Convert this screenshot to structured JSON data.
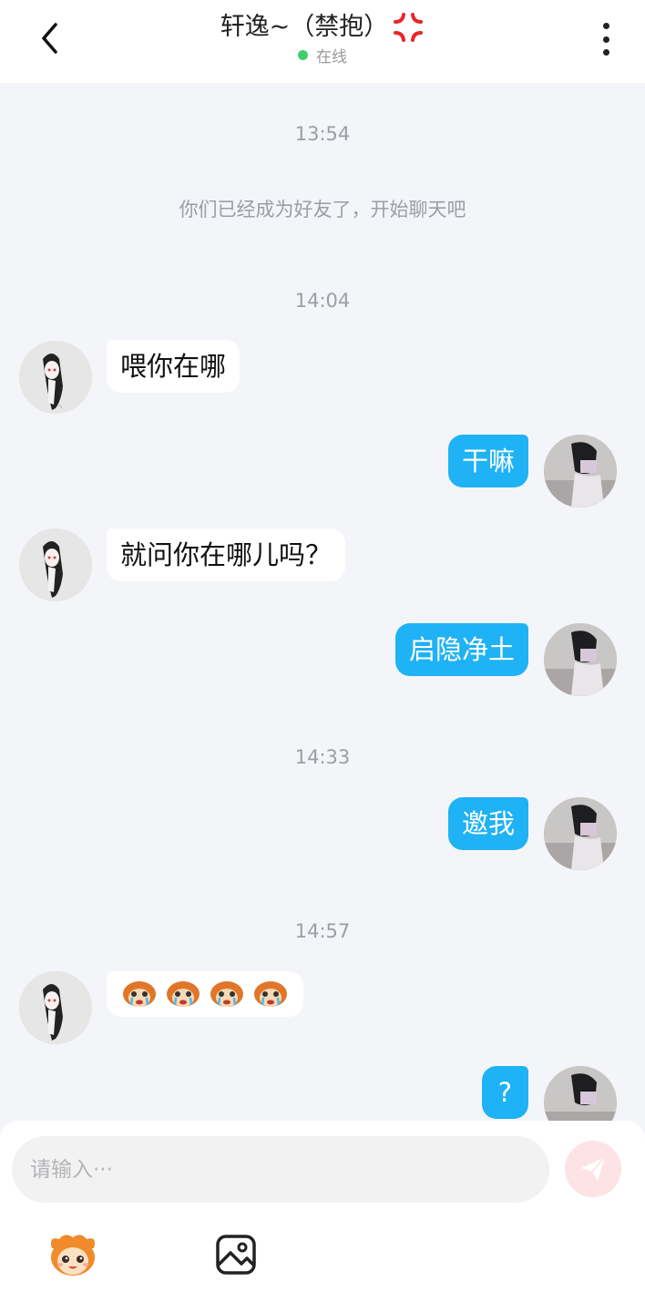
{
  "header": {
    "title": "轩逸~（禁抱）",
    "status": "在线",
    "back_icon": "chevron-left-icon",
    "more_icon": "more-vertical-icon",
    "title_emoji": "anger-symbol-icon"
  },
  "messages": [
    {
      "type": "time",
      "text": "13:54"
    },
    {
      "type": "system",
      "text": "你们已经成为好友了，开始聊天吧"
    },
    {
      "type": "time",
      "text": "14:04"
    },
    {
      "type": "text",
      "from": "them",
      "text": "喂你在哪"
    },
    {
      "type": "text",
      "from": "me",
      "text": "干嘛"
    },
    {
      "type": "text",
      "from": "them",
      "text": "就问你在哪儿吗？"
    },
    {
      "type": "text",
      "from": "me",
      "text": "启隐净土"
    },
    {
      "type": "time",
      "text": "14:33"
    },
    {
      "type": "text",
      "from": "me",
      "text": "邀我"
    },
    {
      "type": "time",
      "text": "14:57"
    },
    {
      "type": "emoji",
      "from": "them",
      "emoji": [
        "crying-monkey-icon",
        "crying-monkey-icon",
        "crying-monkey-icon",
        "crying-monkey-icon"
      ]
    },
    {
      "type": "text",
      "from": "me",
      "text": "?"
    }
  ],
  "composer": {
    "placeholder": "请输入···",
    "send_icon": "send-icon",
    "tools": [
      "emoji-mascot-icon",
      "image-icon"
    ]
  },
  "colors": {
    "my_bubble": "#1fb2f4",
    "their_bubble": "#ffffff",
    "background": "#f4f5f8",
    "online_dot": "#3ecf6b",
    "send_button": "#fde3e6"
  }
}
